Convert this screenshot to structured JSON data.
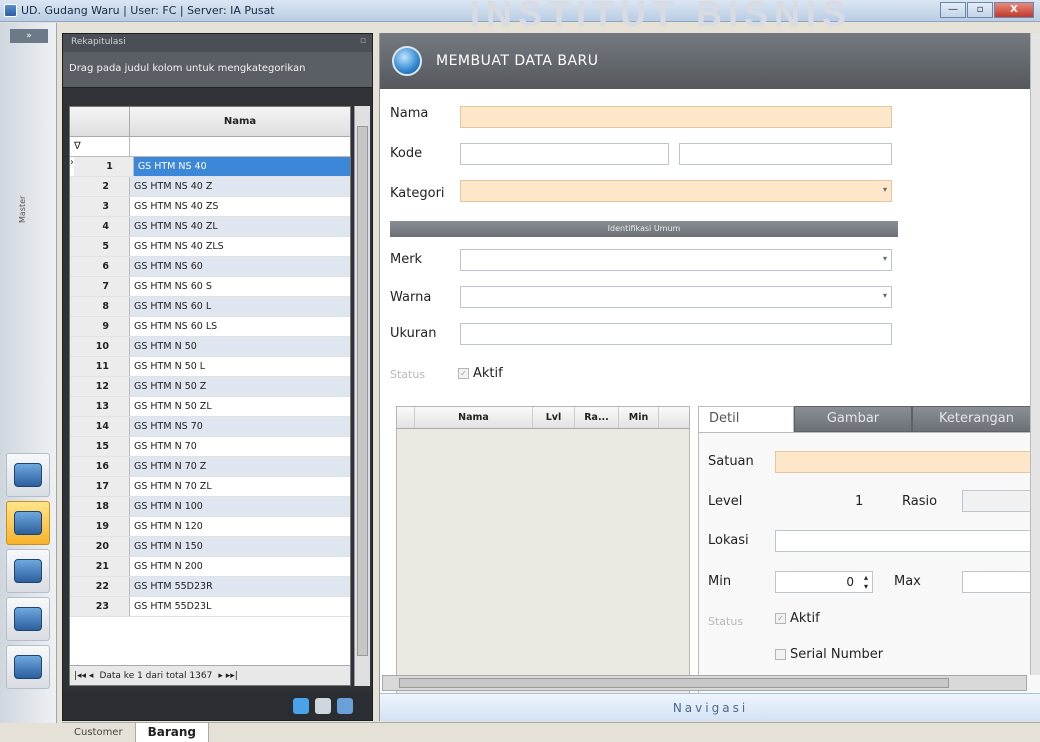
{
  "window": {
    "title": "UD. Gudang Waru  |  User: FC  |  Server: IA Pusat",
    "watermark": "INSTITUT BISNIS",
    "controls": [
      "—",
      "▫",
      "X"
    ]
  },
  "left_strip": {
    "vertical_label": "Master",
    "tools": [
      "laptop-icon",
      "contacts-icon",
      "harddrive-icon",
      "folder-icon",
      "building-icon"
    ]
  },
  "list_panel": {
    "title": "Rekapitulasi",
    "group_hint": "Drag pada judul kolom untuk mengkategorikan",
    "column_header": "Nama",
    "filter_symbol": "∇",
    "rows": [
      {
        "no": "1",
        "nama": "GS HTM NS 40"
      },
      {
        "no": "2",
        "nama": "GS HTM NS 40 Z"
      },
      {
        "no": "3",
        "nama": "GS HTM NS 40 ZS"
      },
      {
        "no": "4",
        "nama": "GS HTM NS 40 ZL"
      },
      {
        "no": "5",
        "nama": "GS HTM NS 40 ZLS"
      },
      {
        "no": "6",
        "nama": "GS HTM NS 60"
      },
      {
        "no": "7",
        "nama": "GS HTM NS 60 S"
      },
      {
        "no": "8",
        "nama": "GS HTM NS 60 L"
      },
      {
        "no": "9",
        "nama": "GS HTM NS 60 LS"
      },
      {
        "no": "10",
        "nama": "GS HTM N 50"
      },
      {
        "no": "11",
        "nama": "GS HTM N 50 L"
      },
      {
        "no": "12",
        "nama": "GS HTM N 50 Z"
      },
      {
        "no": "13",
        "nama": "GS HTM N 50 ZL"
      },
      {
        "no": "14",
        "nama": "GS HTM NS 70"
      },
      {
        "no": "15",
        "nama": "GS HTM N 70"
      },
      {
        "no": "16",
        "nama": "GS HTM N 70 Z"
      },
      {
        "no": "17",
        "nama": "GS HTM N 70 ZL"
      },
      {
        "no": "18",
        "nama": "GS HTM N 100"
      },
      {
        "no": "19",
        "nama": "GS HTM N 120"
      },
      {
        "no": "20",
        "nama": "GS HTM N 150"
      },
      {
        "no": "21",
        "nama": "GS HTM N 200"
      },
      {
        "no": "22",
        "nama": "GS HTM 55D23R"
      },
      {
        "no": "23",
        "nama": "GS HTM 55D23L"
      }
    ],
    "navigator_text": "Data ke 1 dari total 1367",
    "nav_first": "|◂◂ ◂",
    "nav_last": "▸ ▸▸|"
  },
  "form": {
    "header": "MEMBUAT DATA BARU",
    "labels": {
      "nama": "Nama",
      "kode": "Kode",
      "kategori": "Kategori",
      "section": "Identifikasi Umum",
      "merk": "Merk",
      "warna": "Warna",
      "ukuran": "Ukuran",
      "status": "Status",
      "aktif": "Aktif"
    },
    "sub_grid_headers": [
      "Nama",
      "Lvl",
      "Ra...",
      "Min"
    ],
    "tabs": [
      "Detil",
      "Gambar",
      "Keterangan"
    ],
    "detail": {
      "satuan": "Satuan",
      "level": "Level",
      "level_value": "1",
      "rasio": "Rasio",
      "lokasi": "Lokasi",
      "min": "Min",
      "min_value": "0",
      "max": "Max",
      "status": "Status",
      "aktif": "Aktif",
      "serial": "Serial Number"
    },
    "navbar": "Navigasi"
  },
  "bottom_tabs": [
    "Customer",
    "Barang"
  ],
  "colors": {
    "required_field": "#fde7c8",
    "selected_row": "#3d87d8",
    "panel_dark": "#2f3338"
  }
}
